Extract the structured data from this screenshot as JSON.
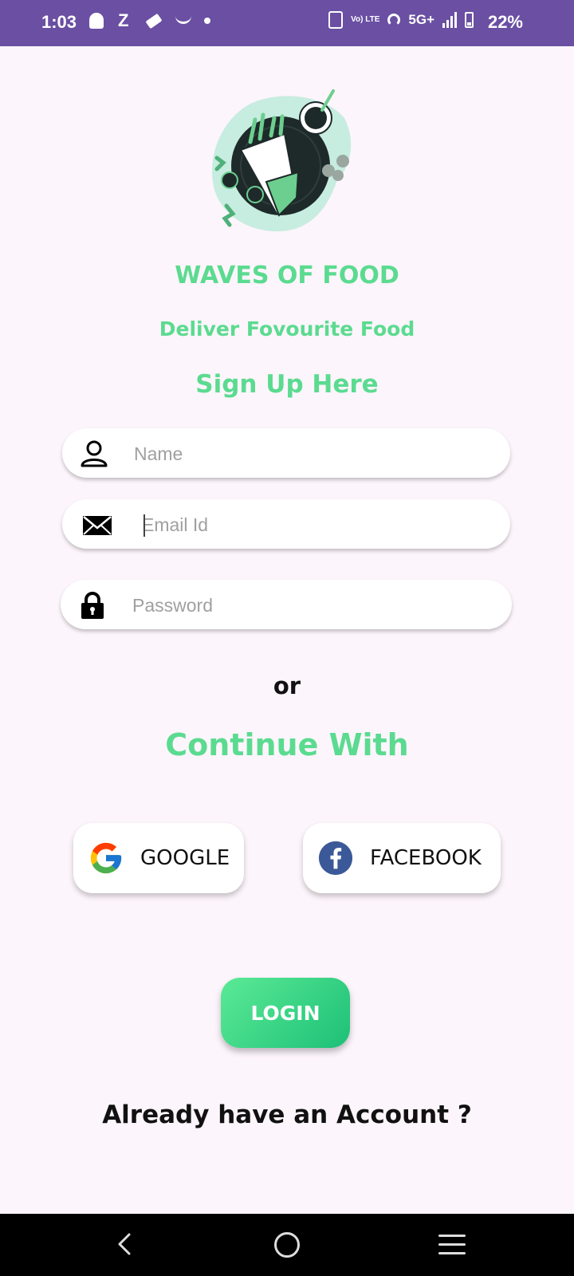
{
  "status_bar": {
    "time": "1:03",
    "network": "5G+",
    "volte": "Vo) LTE",
    "battery": "22%",
    "notification_icons": [
      "snapchat-icon",
      "z-icon",
      "ticket-icon",
      "amazon-icon",
      "dot-icon"
    ]
  },
  "app": {
    "title": "WAVES OF FOOD",
    "tagline": "Deliver Fovourite Food",
    "form_title": "Sign Up Here"
  },
  "form": {
    "name_placeholder": "Name",
    "email_placeholder": "Email Id",
    "password_placeholder": "Password"
  },
  "divider_text": "or",
  "continue_with": "Continue With",
  "social": {
    "google_label": "GOOGLE",
    "facebook_label": "FACEBOOK"
  },
  "login_label": "LOGIN",
  "footer_text": "Already have an Account ?",
  "colors": {
    "accent": "#5bdb90",
    "status_bar": "#6a4fa3",
    "background": "#fcf5fb",
    "login_gradient_start": "#5bea96",
    "login_gradient_end": "#1dc077"
  }
}
